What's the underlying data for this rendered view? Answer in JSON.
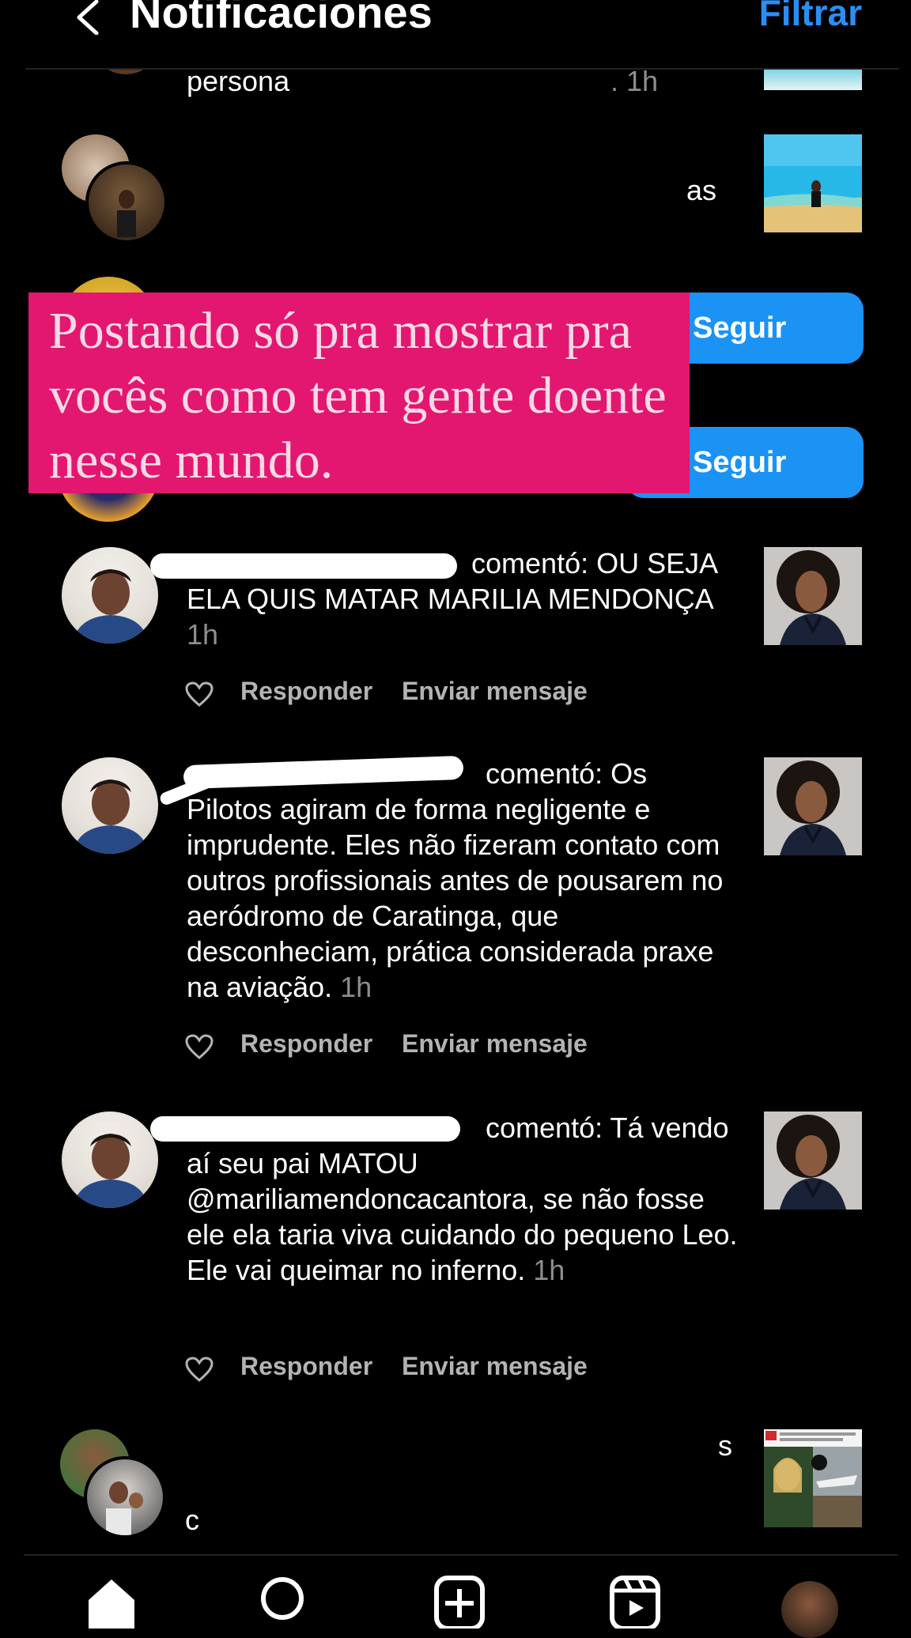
{
  "header": {
    "title": "Notificaciones",
    "filter_label": "Filtrar"
  },
  "colors": {
    "accent": "#1a93f5",
    "overlay": "#e3176f",
    "meta": "#8e8e8e"
  },
  "top_partial": {
    "text": "persona",
    "time": ". 1h"
  },
  "row2": {
    "text_right": "as"
  },
  "follow_buttons": [
    {
      "label": "Seguir"
    },
    {
      "label": "Seguir"
    }
  ],
  "overlay": {
    "text": "Postando só pra mostrar pra vocês como tem gente doente nesse mundo."
  },
  "comments": [
    {
      "username_visible": "",
      "action": "comentó:",
      "text": "OU SEJA ELA QUIS MATAR MARILIA MENDONÇA",
      "time": "1h",
      "reply_label": "Responder",
      "dm_label": "Enviar mensaje"
    },
    {
      "username_visible": "",
      "action": "comentó:",
      "text": "Os Pilotos agiram de forma negligente e imprudente. Eles não fizeram contato com outros profissionais antes de pousarem no aeródromo de Caratinga, que desconheciam, prática considerada praxe na aviação.",
      "time": "1h",
      "reply_label": "Responder",
      "dm_label": "Enviar mensaje"
    },
    {
      "username_visible": "",
      "action": "comentó:",
      "text": "Tá vendo aí seu pai MATOU @mariliamendoncacantora, se não fosse ele ela taria viva cuidando do pequeno Leo. Ele vai queimar no inferno.",
      "time": "1h",
      "reply_label": "Responder",
      "dm_label": "Enviar mensaje"
    }
  ],
  "bottom_row": {
    "text_right": "s",
    "text_left": "c"
  },
  "nav_icons": [
    "home-icon",
    "search-icon",
    "create-icon",
    "reels-icon",
    "profile-avatar"
  ]
}
